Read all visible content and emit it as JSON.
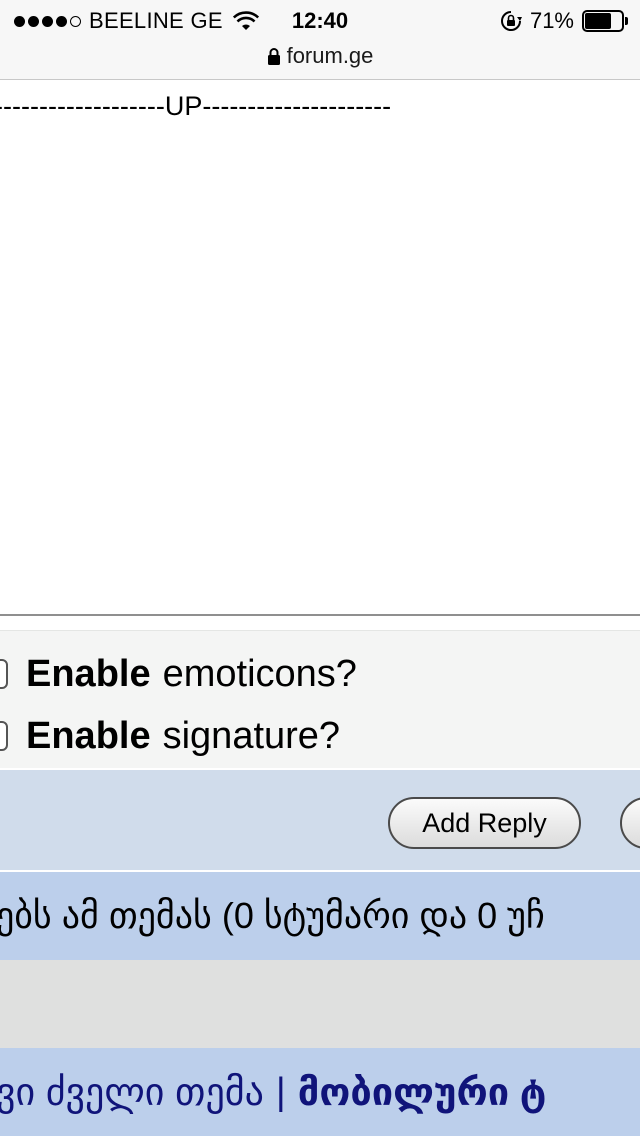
{
  "status_bar": {
    "carrier": "BEELINE GE",
    "time": "12:40",
    "battery_percent": "71%",
    "battery_level": 0.71,
    "url": "forum.ge"
  },
  "editor": {
    "content": "-------------------UP---------------------"
  },
  "options": {
    "emoticons_bold": "Enable",
    "emoticons_rest": "emoticons?",
    "signature_bold": "Enable",
    "signature_rest": "signature?"
  },
  "actions": {
    "add_reply": "Add Reply"
  },
  "viewers": {
    "text": "ებს ამ თემას (0 სტუმარი და 0 უჩ"
  },
  "footer": {
    "link_old_topic": "ვი ძველი თემა",
    "separator": "|",
    "link_mobile": "მობილური ტ"
  }
}
